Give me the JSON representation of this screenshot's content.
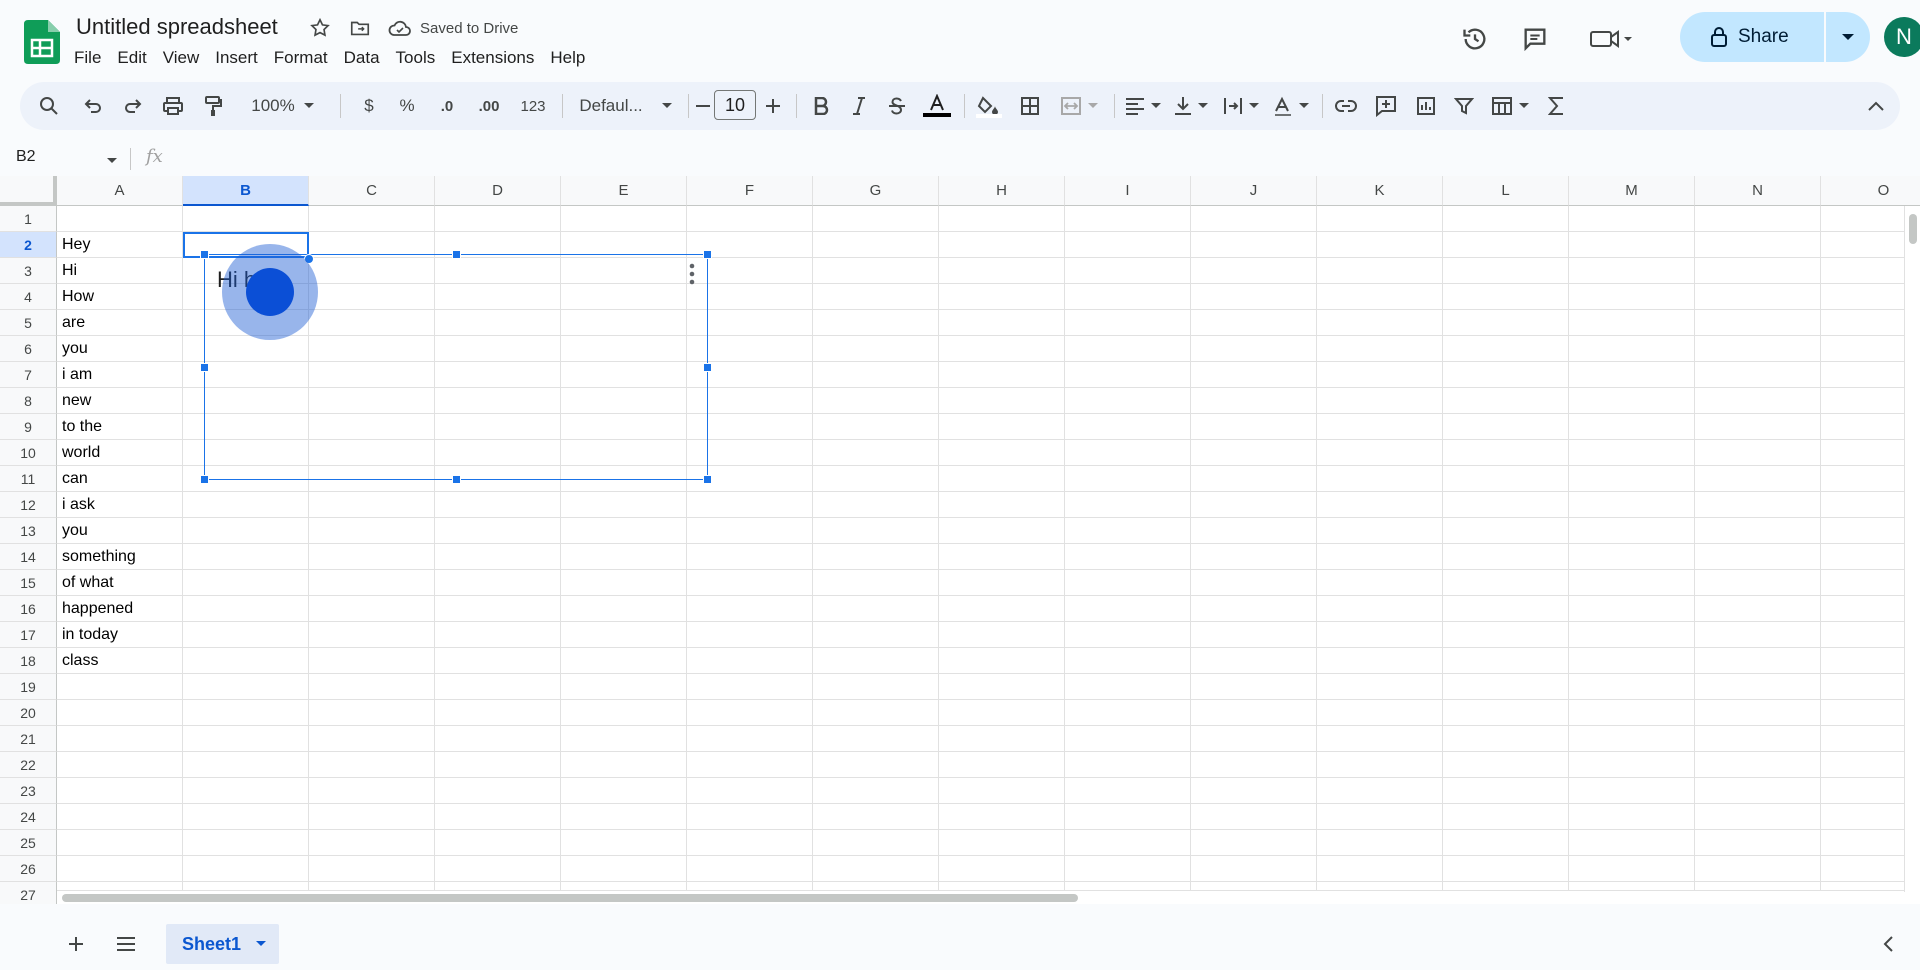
{
  "app": {
    "title": "Untitled spreadsheet",
    "saved_status": "Saved to Drive",
    "brand_color": "#0f9d58"
  },
  "menu": [
    "File",
    "Edit",
    "View",
    "Insert",
    "Format",
    "Data",
    "Tools",
    "Extensions",
    "Help"
  ],
  "share": {
    "label": "Share",
    "color": "#c2e7ff"
  },
  "avatar": {
    "initial": "N",
    "color": "#0b7a5c"
  },
  "toolbar": {
    "zoom": "100%",
    "currency": "$",
    "percent": "%",
    "decrease_decimal": ".0",
    "increase_decimal": ".00",
    "number_format": "123",
    "font": "Defaul...",
    "font_size": "10"
  },
  "formula_bar": {
    "name_box": "B2",
    "fx": "fx"
  },
  "columns": [
    "A",
    "B",
    "C",
    "D",
    "E",
    "F",
    "G",
    "H",
    "I",
    "J",
    "K",
    "L",
    "M",
    "N",
    "O"
  ],
  "selected_column": "B",
  "rows": [
    "1",
    "2",
    "3",
    "4",
    "5",
    "6",
    "7",
    "8",
    "9",
    "10",
    "11",
    "12",
    "13",
    "14",
    "15",
    "16",
    "17",
    "18",
    "19",
    "20",
    "21",
    "22",
    "23",
    "24",
    "25",
    "26",
    "27"
  ],
  "selected_row": "2",
  "column_a_values": [
    "",
    "Hey",
    "Hi",
    "How",
    "are",
    "you",
    "i am",
    "new",
    "to the",
    "world",
    "can",
    "i ask",
    "you",
    "something",
    "of what",
    "happened",
    "in today",
    "class"
  ],
  "drawing": {
    "text": "Hi hello"
  },
  "sheets": [
    {
      "name": "Sheet1",
      "active": true
    }
  ]
}
